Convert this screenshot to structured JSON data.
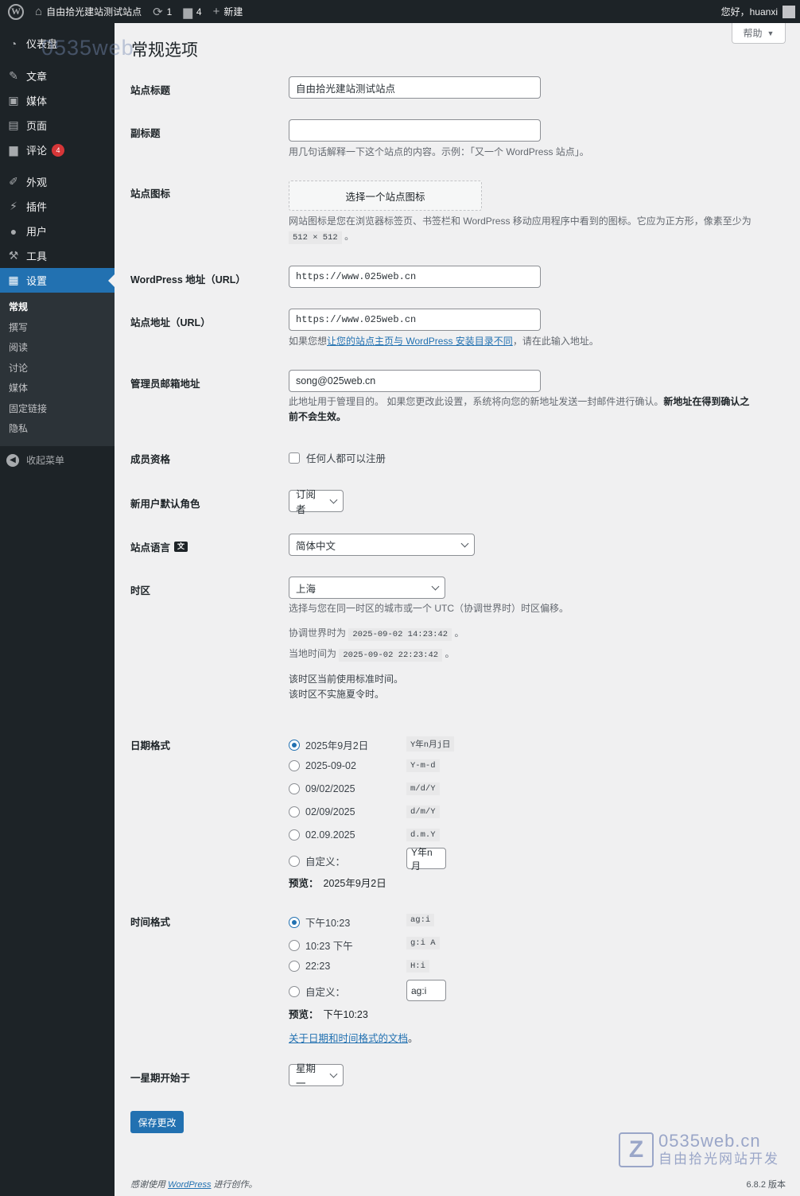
{
  "admin_bar": {
    "site_name": "自由拾光建站测试站点",
    "updates_count": "1",
    "comments_count": "4",
    "new_label": "新建",
    "greeting": "您好，huanxi"
  },
  "menu": {
    "dashboard": "仪表盘",
    "posts": "文章",
    "media": "媒体",
    "pages": "页面",
    "comments": "评论",
    "comments_badge": "4",
    "appearance": "外观",
    "plugins": "插件",
    "users": "用户",
    "tools": "工具",
    "settings": "设置",
    "submenu": [
      "常规",
      "撰写",
      "阅读",
      "讨论",
      "媒体",
      "固定链接",
      "隐私"
    ],
    "collapse": "收起菜单",
    "watermark": "0535web"
  },
  "page": {
    "help_label": "帮助",
    "title": "常规选项"
  },
  "fields": {
    "site_title_label": "站点标题",
    "site_title_value": "自由拾光建站测试站点",
    "tagline_label": "副标题",
    "tagline_value": "",
    "tagline_desc": "用几句话解释一下这个站点的内容。示例：「又一个 WordPress 站点」。",
    "site_icon_label": "站点图标",
    "site_icon_button": "选择一个站点图标",
    "site_icon_desc": "网站图标是您在浏览器标签页、书签栏和 WordPress 移动应用程序中看到的图标。它应为正方形，像素至少为",
    "site_icon_size": "512 × 512",
    "site_icon_end": "。",
    "wp_url_label": "WordPress 地址（URL）",
    "wp_url_value": "https://www.025web.cn",
    "site_url_label": "站点地址（URL）",
    "site_url_value": "https://www.025web.cn",
    "site_url_desc_pre": "如果您想",
    "site_url_desc_link": "让您的站点主页与 WordPress 安装目录不同",
    "site_url_desc_post": "，请在此输入地址。",
    "admin_email_label": "管理员邮箱地址",
    "admin_email_value": "song@025web.cn",
    "admin_email_desc": "此地址用于管理目的。 如果您更改此设置，系统将向您的新地址发送一封邮件进行确认。",
    "admin_email_desc_bold1": "新地址在得到确认之",
    "admin_email_desc_bold2": "前不会生效。",
    "membership_label": "成员资格",
    "membership_checkbox": "任何人都可以注册",
    "default_role_label": "新用户默认角色",
    "default_role_value": "订阅者",
    "language_label": "站点语言",
    "language_value": "简体中文",
    "timezone_label": "时区",
    "timezone_value": "上海",
    "timezone_desc": "选择与您在同一时区的城市或一个 UTC（协调世界时）时区偏移。",
    "utc_label": "协调世界时为",
    "utc_time": "2025-09-02 14:23:42",
    "local_label": "当地时间为",
    "local_time": "2025-09-02 22:23:42",
    "period_end": "。",
    "std_time": "该时区当前使用标准时间。",
    "no_dst": "该时区不实施夏令时。",
    "date_format_label": "日期格式",
    "date_formats": [
      {
        "display": "2025年9月2日",
        "code": "Y年n月j日",
        "checked": true
      },
      {
        "display": "2025-09-02",
        "code": "Y-m-d",
        "checked": false
      },
      {
        "display": "09/02/2025",
        "code": "m/d/Y",
        "checked": false
      },
      {
        "display": "02/09/2025",
        "code": "d/m/Y",
        "checked": false
      },
      {
        "display": "02.09.2025",
        "code": "d.m.Y",
        "checked": false
      }
    ],
    "date_custom_label": "自定义：",
    "date_custom_value": "Y年n月",
    "preview_label": "预览：",
    "date_preview": "2025年9月2日",
    "time_format_label": "时间格式",
    "time_formats": [
      {
        "display": "下午10:23",
        "code": "ag:i",
        "checked": true
      },
      {
        "display": "10:23 下午",
        "code": "g:i A",
        "checked": false
      },
      {
        "display": "22:23",
        "code": "H:i",
        "checked": false
      }
    ],
    "time_custom_label": "自定义：",
    "time_custom_value": "ag:i",
    "time_preview": "下午10:23",
    "docs_link": "关于日期和时间格式的文档",
    "docs_end": "。",
    "week_start_label": "一星期开始于",
    "week_start_value": "星期一"
  },
  "save_button": "保存更改",
  "footer": {
    "thanks_pre": "感谢使用 ",
    "thanks_link": "WordPress",
    "thanks_post": " 进行创作。",
    "version": "6.8.2 版本"
  },
  "watermark": {
    "line1": "0535web.cn",
    "line2": "自由拾光网站开发"
  },
  "colors": {
    "accent": "#2271b1",
    "admin_bg": "#1d2327",
    "badge": "#d63638",
    "page_bg": "#f0f0f1"
  }
}
